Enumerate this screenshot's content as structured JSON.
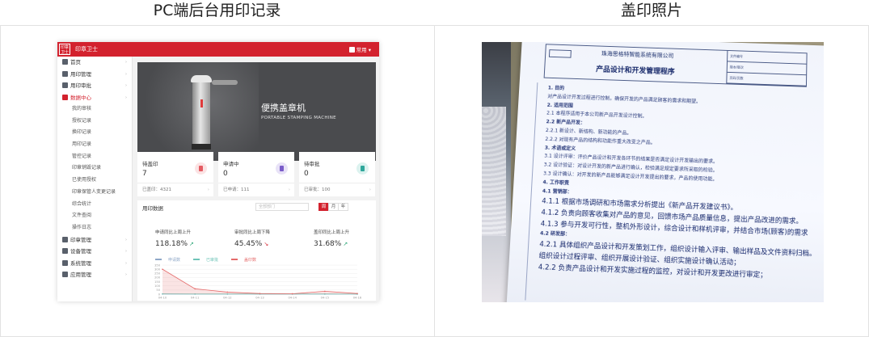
{
  "captions": {
    "left": "PC端后台用印记录",
    "right": "盖印照片"
  },
  "admin": {
    "app_title": "印章卫士",
    "logo_text": "印章卫士",
    "user_menu": "常用",
    "nav": [
      {
        "label": "首页",
        "icon": "home-icon"
      },
      {
        "label": "用印管理",
        "icon": "document-icon"
      },
      {
        "label": "用印审批",
        "icon": "approval-icon"
      },
      {
        "label": "数据中心",
        "icon": "chart-icon",
        "active": true
      }
    ],
    "sub_nav": [
      "我的审核",
      "授权记录",
      "换印记录",
      "用印记录",
      "管控记录",
      "印章销毁记录",
      "已使用授权",
      "印章保管人变更记录",
      "综合统计",
      "文件查阅",
      "操作日志"
    ],
    "nav_bottom": [
      {
        "label": "印章管理",
        "icon": "seal-icon"
      },
      {
        "label": "设备管理",
        "icon": "device-icon"
      },
      {
        "label": "系统管理",
        "icon": "settings-icon"
      },
      {
        "label": "应用管理",
        "icon": "apps-icon"
      }
    ],
    "banner": {
      "title": "便携盖章机",
      "subtitle": "PORTABLE STAMPING MACHINE"
    },
    "stats": [
      {
        "label": "待盖印",
        "value": "7",
        "foot": "已盖印：4321",
        "color": "#e45b62",
        "bg": "#fbe3e4"
      },
      {
        "label": "申请中",
        "value": "0",
        "foot": "已申请：111",
        "color": "#7a5cc9",
        "bg": "#e8e2f7"
      },
      {
        "label": "待审批",
        "value": "0",
        "foot": "已审批：100",
        "color": "#2fa79b",
        "bg": "#dcf2ef"
      }
    ],
    "chart_panel": {
      "title": "用印数据",
      "dept_placeholder": "全部部门",
      "tabs": [
        "周",
        "月",
        "年"
      ],
      "kpis": [
        {
          "label": "申请同比上周上升",
          "value": "118.18%",
          "trend": "up"
        },
        {
          "label": "审批同比上周下降",
          "value": "45.45%",
          "trend": "down"
        },
        {
          "label": "盖印同比上周上升",
          "value": "31.68%",
          "trend": "up"
        }
      ],
      "trend_colors": {
        "up": "#2fa779",
        "down": "#d3222e"
      }
    },
    "chart_data": {
      "type": "area",
      "x": [
        "04-10",
        "04-11",
        "04-12",
        "04-13",
        "04-14",
        "04-15",
        "04-16"
      ],
      "ylim": [
        0,
        350
      ],
      "yticks": [
        0,
        50,
        100,
        150,
        200,
        250,
        300,
        350
      ],
      "series": [
        {
          "name": "申请数",
          "color": "#8fa8c8",
          "values": [
            2,
            1,
            1,
            1,
            1,
            1,
            1
          ]
        },
        {
          "name": "已审批",
          "color": "#6fc4b8",
          "values": [
            3,
            2,
            2,
            2,
            2,
            2,
            1
          ]
        },
        {
          "name": "盖印数",
          "color": "#e56b6b",
          "values": [
            300,
            65,
            25,
            8,
            5,
            35,
            8
          ]
        }
      ]
    }
  },
  "photo": {
    "company": "珠海思格特智能系统有限公司",
    "doc_title": "产品设计和开发管理程序",
    "meta": [
      "文件编号",
      "版本/版次",
      "页码/页数"
    ],
    "lines": [
      {
        "t": "1. 目的",
        "b": true
      },
      {
        "t": "对产品设计开发过程进行控制，确保开发的产品满足顾客的需求和期望。"
      },
      {
        "t": "2. 适用范围",
        "b": true
      },
      {
        "t": "2.1 本程序适用于本公司新产品开发设计控制。"
      },
      {
        "t": "2.2 新产品开发：",
        "b": true
      },
      {
        "t": "2.2.1 新设计、新结构、新功能的产品。"
      },
      {
        "t": "2.2.2 对现有产品的结构和功能作重大改变之产品。"
      },
      {
        "t": "3. 术语或定义",
        "b": true
      },
      {
        "t": "3.1 设计评审：评价产品设计和开发各环节的结果是否满足设计开发输出的要求。"
      },
      {
        "t": "3.2 设计验证：对设计开发的新产品进行确认，检验满足规定要求所采取的检验。"
      },
      {
        "t": "3.3 设计确认：对开发的新产品能够满足设计开发提出的要求，产品的使用功能。"
      },
      {
        "t": "4. 工作职责",
        "b": true
      },
      {
        "t": "4.1 营销部：",
        "b": true
      },
      {
        "t": "4.1.1 根据市场调研和市场需求分析提出《新产品开发建议书》。",
        "big": true
      },
      {
        "t": "4.1.2 负责向顾客收集对产品的意见，回馈市场产品质量信息，提出产品改进的需求。",
        "big": true
      },
      {
        "t": "4.1.3 参与开发可行性，整机外形设计，综合设计和样机评审，并结合市场(顾客)的需求",
        "big": true
      },
      {
        "t": "4.2 研发部：",
        "b": true
      },
      {
        "t": "4.2.1 具体组织产品设计和开发策划工作，组织设计输入评审、输出样品及文件资料归档。",
        "big": true
      },
      {
        "t": "组织设计过程评审、组织开展设计验证、组织实施设计确认活动；",
        "big": true
      },
      {
        "t": "4.2.2 负责产品设计和开发实施过程的监控，对设计和开发更改进行审定；",
        "big": true
      }
    ]
  }
}
